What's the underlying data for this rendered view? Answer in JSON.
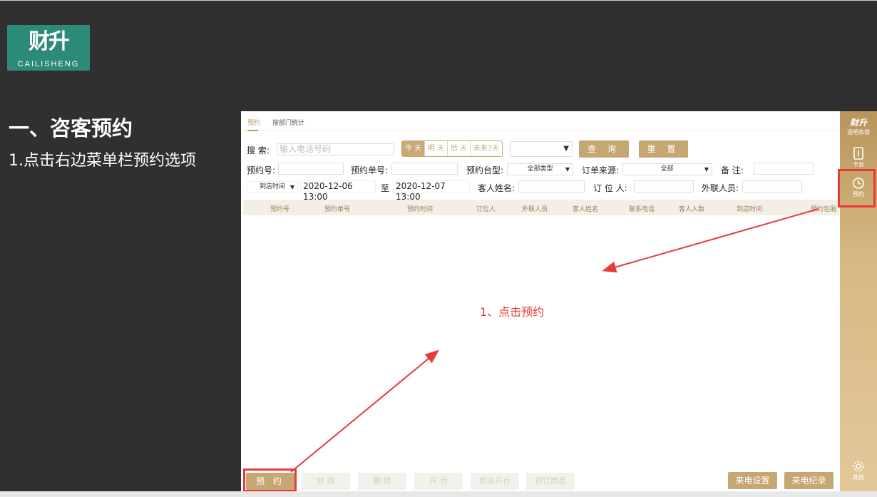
{
  "slide": {
    "logo_mark": "财升",
    "logo_text": "CAILISHENG",
    "title": "一、咨客预约",
    "subtitle": "1.点击右边菜单栏预约选项"
  },
  "app": {
    "tabs": [
      {
        "label": "预约",
        "active": true
      },
      {
        "label": "按部门统计",
        "active": false
      }
    ],
    "search": {
      "label": "搜  索:",
      "placeholder": "输入电话号码",
      "day_options": [
        {
          "label": "今 天",
          "active": true
        },
        {
          "label": "明 天",
          "active": false
        },
        {
          "label": "后 天",
          "active": false
        },
        {
          "label": "未来7天",
          "active": false
        }
      ],
      "dropdown_value": "",
      "query_button": "查 询",
      "reset_button": "重 置"
    },
    "filters": {
      "reservation_no_label": "预约号:",
      "reservation_order_label": "预约单号:",
      "table_type_label": "预约台型:",
      "table_type_value": "全部类型",
      "order_source_label": "订单来源:",
      "order_source_value": "全部",
      "remark_label": "备  注:",
      "time_type_value": "到店时间",
      "start_time": "2020-12-06 13:00",
      "to_label": "至",
      "end_time": "2020-12-07 13:00",
      "guest_name_label": "客人姓名:",
      "booker_label": "订 位 人:",
      "liaison_label": "外联人员:"
    },
    "table_headers": [
      "预约号",
      "预约单号",
      "预约时间",
      "订位人",
      "外联人员",
      "客人姓名",
      "联系电话",
      "客人人数",
      "到店时间",
      "预约包厢"
    ],
    "annotation": "1、点击预约",
    "footer": {
      "reserve_button": "预 约",
      "modify_button": "修 改",
      "delete_button": "删 除",
      "seat_button": "开 台",
      "arrive_button": "到店开台",
      "preorder_button": "预订商品",
      "call_settings_button": "来电设置",
      "call_log_button": "来电纪录"
    }
  },
  "sidebar": {
    "brand": "财升",
    "brand_sub": "酒吧收银",
    "items": [
      {
        "label": "卡台",
        "icon": "card-icon"
      },
      {
        "label": "预约",
        "icon": "clock-icon"
      },
      {
        "label": "其他",
        "icon": "gear-icon"
      }
    ]
  },
  "colors": {
    "gold": "#c6a672",
    "annotation_red": "#e8393b",
    "background": "#303030"
  }
}
